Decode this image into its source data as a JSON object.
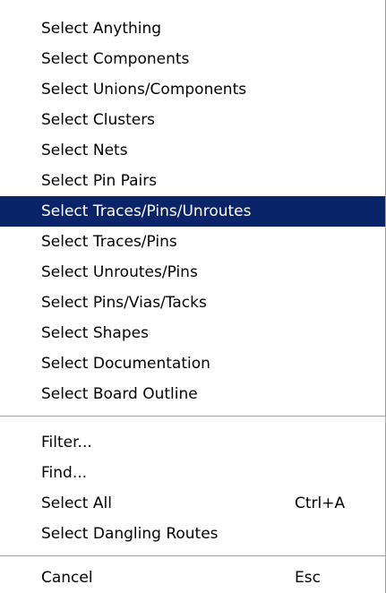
{
  "menu": {
    "select_items": [
      {
        "label": "Select Anything"
      },
      {
        "label": "Select Components"
      },
      {
        "label": "Select Unions/Components"
      },
      {
        "label": "Select Clusters"
      },
      {
        "label": "Select Nets"
      },
      {
        "label": "Select Pin Pairs"
      },
      {
        "label": "Select Traces/Pins/Unroutes",
        "highlighted": true
      },
      {
        "label": "Select Traces/Pins"
      },
      {
        "label": "Select Unroutes/Pins"
      },
      {
        "label": "Select Pins/Vias/Tacks"
      },
      {
        "label": "Select Shapes"
      },
      {
        "label": "Select Documentation"
      },
      {
        "label": "Select Board Outline"
      }
    ],
    "action_items": [
      {
        "label": "Filter..."
      },
      {
        "label": "Find..."
      },
      {
        "label": "Select All",
        "shortcut": "Ctrl+A"
      },
      {
        "label": "Select Dangling Routes"
      }
    ],
    "cancel_item": {
      "label": "Cancel",
      "shortcut": "Esc"
    },
    "colors": {
      "highlight_bg": "#0a246a",
      "highlight_text": "#ffffff",
      "background": "#ffffff",
      "text": "#000000"
    }
  }
}
